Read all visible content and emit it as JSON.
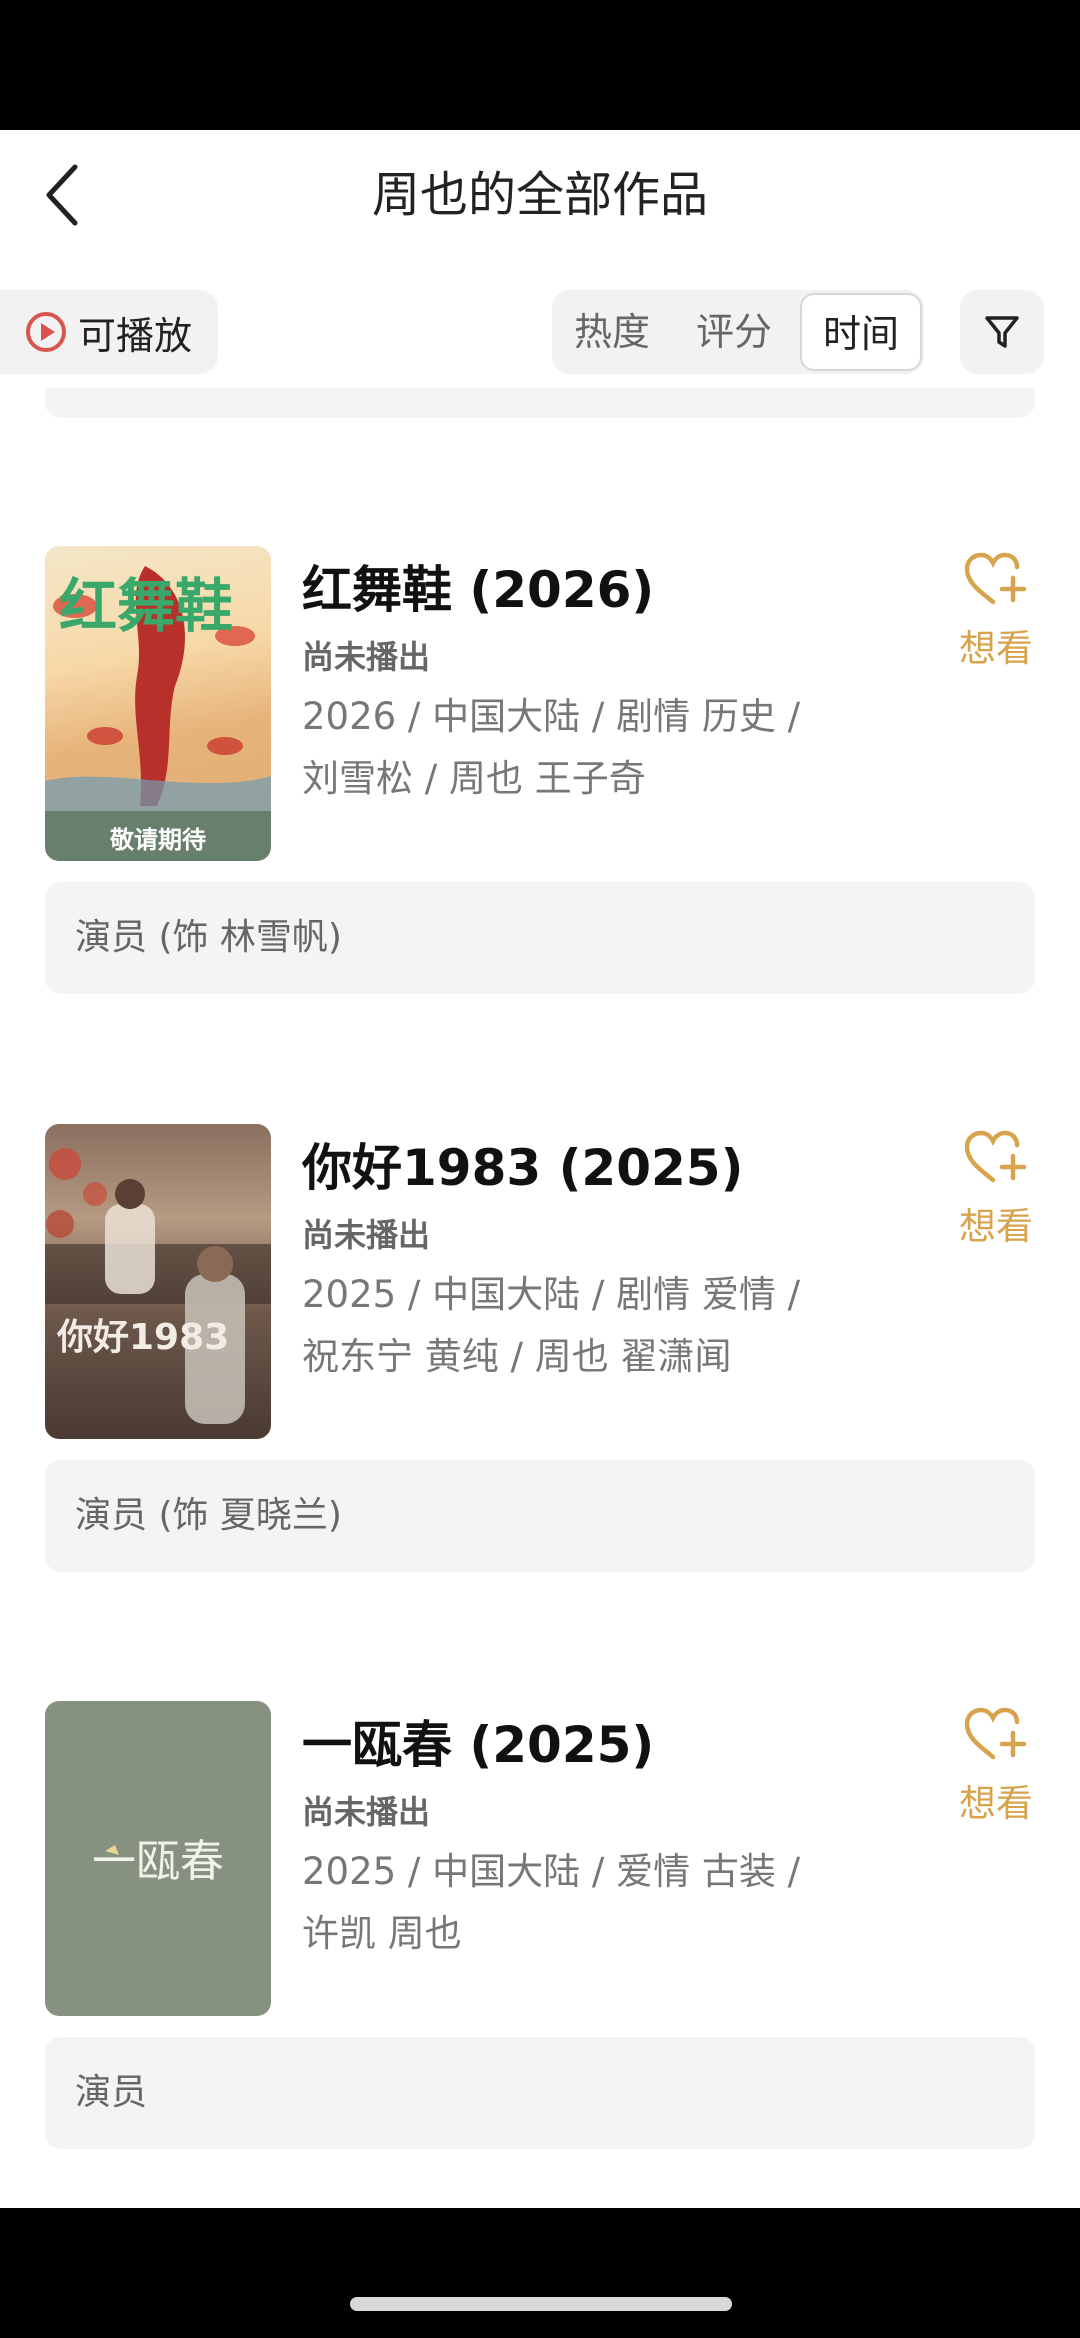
{
  "header": {
    "title": "周也的全部作品"
  },
  "toolbar": {
    "playable_label": "可播放",
    "sort_options": [
      "热度",
      "评分",
      "时间"
    ],
    "active_sort": "时间"
  },
  "movies": [
    {
      "title": "红舞鞋 (2026)",
      "status": "尚未播出",
      "meta_line1": "2026 / 中国大陆 / 剧情 历史 /",
      "meta_line2": "刘雪松 / 周也 王子奇",
      "want_label": "想看",
      "role": "演员 (饰 林雪帆)",
      "poster": {
        "title_text": "红舞鞋",
        "bottom_text": "敬请期待"
      }
    },
    {
      "title": "你好1983 (2025)",
      "status": "尚未播出",
      "meta_line1": "2025 / 中国大陆 / 剧情 爱情 /",
      "meta_line2": "祝东宁 黄纯 / 周也 翟潇闻",
      "want_label": "想看",
      "role": "演员 (饰 夏晓兰)",
      "poster": {
        "title_text": "你好1983"
      }
    },
    {
      "title": "一瓯春 (2025)",
      "status": "尚未播出",
      "meta_line1": "2025 / 中国大陆 / 爱情 古装 /",
      "meta_line2": "许凯 周也",
      "want_label": "想看",
      "role": "演员",
      "poster": {
        "title_text": "一瓯春"
      }
    }
  ],
  "colors": {
    "accent": "#d7a34d",
    "play_icon": "#d9534f"
  }
}
